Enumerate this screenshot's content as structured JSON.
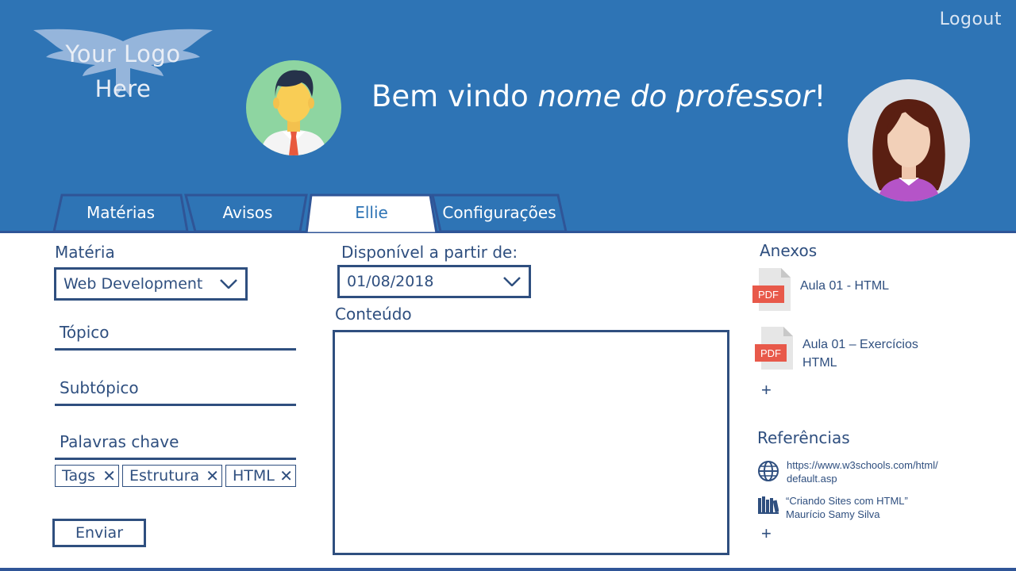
{
  "header": {
    "logo_line1": "Your Logo",
    "logo_line2": "Here",
    "logout_label": "Logout",
    "welcome_prefix": "Bem vindo ",
    "welcome_name": "nome do professor",
    "welcome_suffix": "!"
  },
  "tabs": [
    {
      "label": "Matérias"
    },
    {
      "label": "Avisos"
    },
    {
      "label": "Ellie",
      "active": true
    },
    {
      "label": "Configurações"
    }
  ],
  "form": {
    "materia_label": "Matéria",
    "materia_value": "Web Development",
    "topico_label": "Tópico",
    "subtopico_label": "Subtópico",
    "palavras_label": "Palavras chave",
    "tags": [
      "Tags",
      "Estrutura",
      "HTML"
    ],
    "tag_remove_glyph": "✕",
    "send_label": "Enviar",
    "disponivel_label": "Disponível a partir de:",
    "disponivel_value": "01/08/2018",
    "conteudo_label": "Conteúdo"
  },
  "anexos": {
    "title": "Anexos",
    "pdf_badge": "PDF",
    "files": [
      {
        "name": "Aula 01 - HTML"
      },
      {
        "name_line1": "Aula 01 – Exercícios",
        "name_line2": "HTML"
      }
    ],
    "add_glyph": "+"
  },
  "referencias": {
    "title": "Referências",
    "items": [
      {
        "icon": "globe-icon",
        "line1": "https://www.w3schools.com/html/",
        "line2": "default.asp"
      },
      {
        "icon": "books-icon",
        "line1": "“Criando Sites com HTML”",
        "line2": "Maurício Samy Silva"
      }
    ],
    "add_glyph": "+"
  },
  "colors": {
    "header_bg": "#2e74b5",
    "text_dark": "#2f4f7f",
    "pdf_red": "#e8594a",
    "white": "#ffffff"
  }
}
